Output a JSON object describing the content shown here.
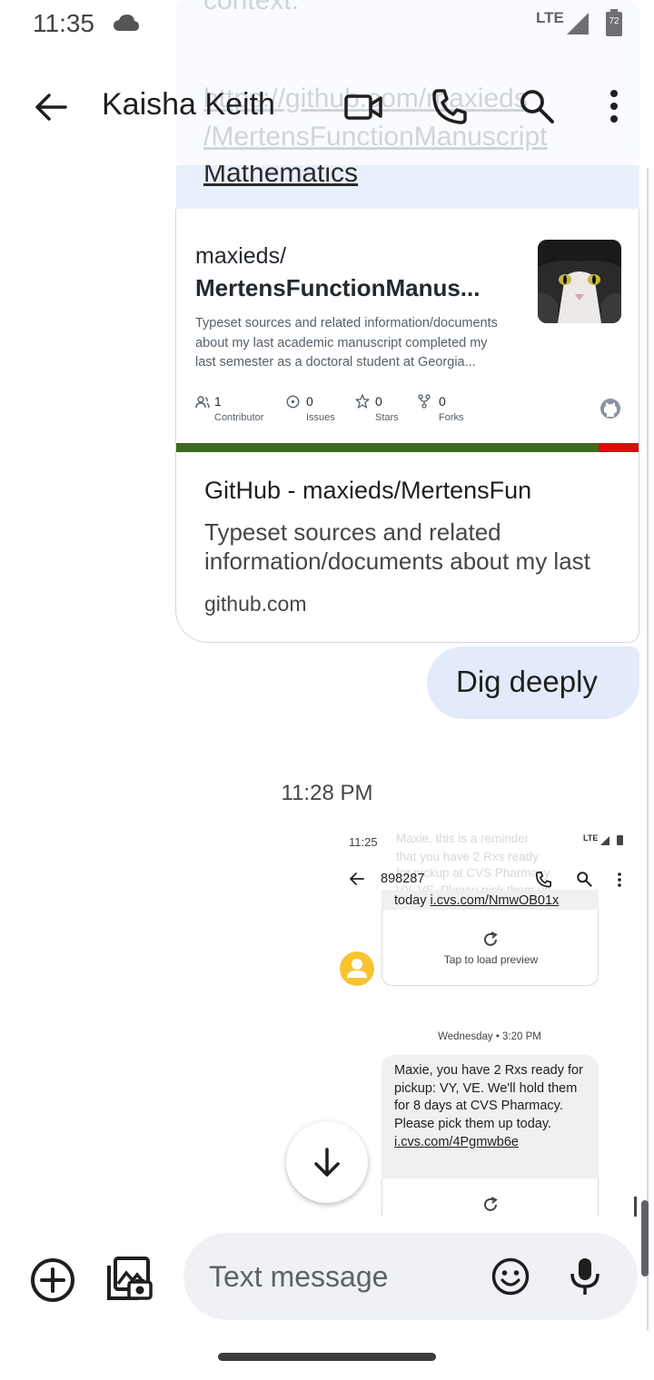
{
  "status_bar": {
    "time": "11:35",
    "network": "LTE",
    "battery": "72"
  },
  "ghost": {
    "context_text": "context.",
    "link_line1": "https://github.com/maxieds",
    "link_line2": "/MertensFunctionManuscript"
  },
  "app_bar": {
    "contact_name": "Kaisha Keith"
  },
  "conversation": {
    "prev_bubble_text": "Mathematics",
    "link_preview": {
      "owner": "maxieds/",
      "repo": "MertensFunctionManus...",
      "description": "Typeset sources and related information/documents about my last academic manuscript completed my last semester as a doctoral student at Georgia...",
      "stats": [
        {
          "value": "1",
          "label": "Contributor",
          "icon": "people-icon"
        },
        {
          "value": "0",
          "label": "Issues",
          "icon": "issue-icon"
        },
        {
          "value": "0",
          "label": "Stars",
          "icon": "star-icon"
        },
        {
          "value": "0",
          "label": "Forks",
          "icon": "fork-icon"
        }
      ],
      "title": "GitHub - maxieds/MertensFun",
      "snippet": "Typeset sources and related information/documents about my last",
      "domain": "github.com",
      "lang_colors": [
        "#3e6b1f",
        "#e00a0a"
      ]
    },
    "outgoing_text": "Dig deeply",
    "timestamp": "11:28 PM",
    "screenshot": {
      "time": "11:25",
      "network": "LTE",
      "contact": "898287",
      "ghost_lines": [
        "Maxie, this is a reminder",
        "that you have 2 Rxs ready",
        "for pickup at CVS Pharmacy",
        "VY, VE. Please pick them up"
      ],
      "bubble1_prefix": "today ",
      "bubble1_link": "i.cvs.com/NmwOB01x",
      "tap_to_load": "Tap to load preview",
      "date_divider": "Wednesday • 3:20 PM",
      "bubble2_text": "Maxie, you have 2 Rxs ready for pickup: VY, VE. We'll hold them for 8 days at CVS Pharmacy. Please pick them up today. ",
      "bubble2_link": "i.cvs.com/4Pgmwb6e"
    }
  },
  "compose": {
    "placeholder": "Text message"
  },
  "colors": {
    "outgoing_bubble": "#e3ebfb",
    "compose_bg": "#eff1f4",
    "avatar": "#f7c430"
  }
}
